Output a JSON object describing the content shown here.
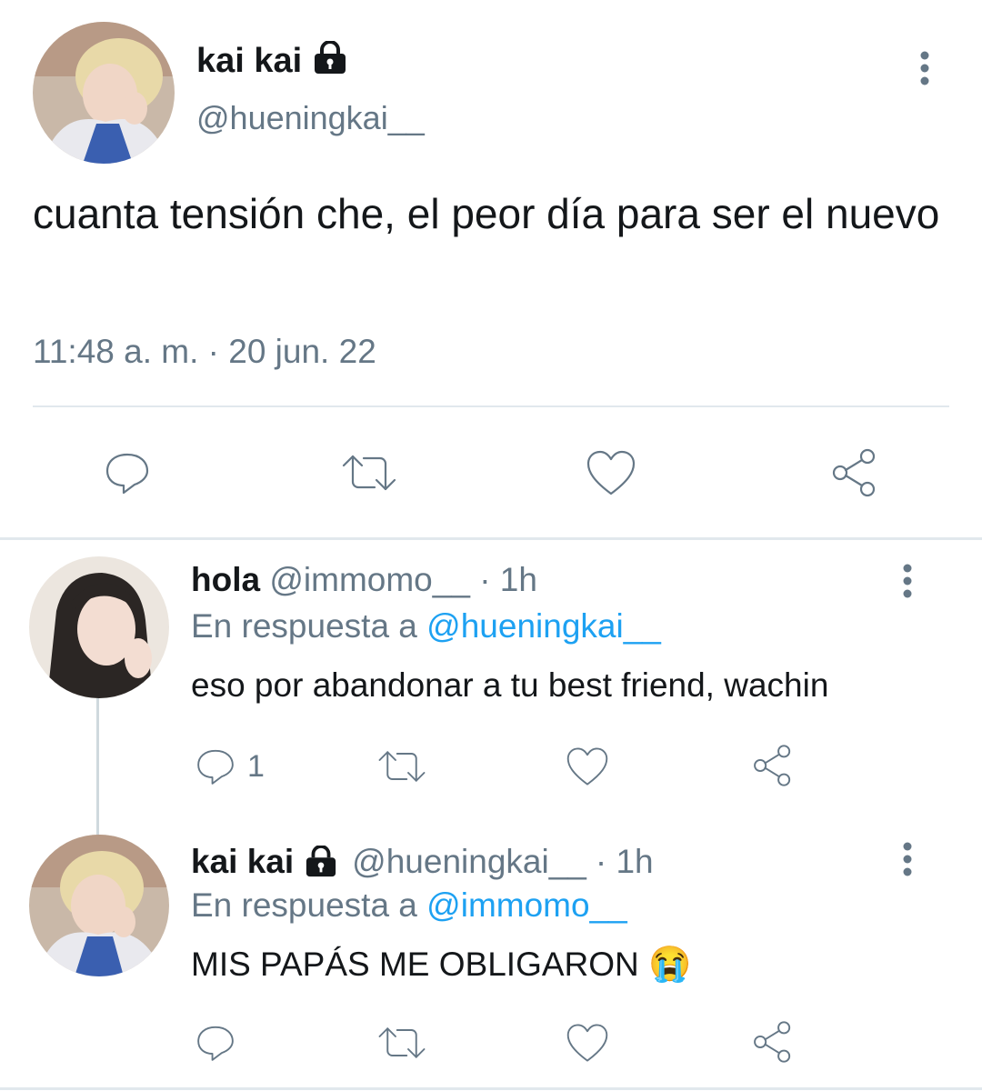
{
  "main_tweet": {
    "author_name": "kai kai",
    "handle": "@hueningkai__",
    "text": "cuanta tensión che, el peor día para ser el nuevo",
    "timestamp": "11:48 a. m. · 20 jun. 22"
  },
  "replies": [
    {
      "author_name": "hola",
      "handle": "@immomo__",
      "time": "· 1h",
      "reply_prefix": "En respuesta a",
      "reply_to": "@hueningkai__",
      "text": "eso por abandonar a tu best friend, wachin",
      "reply_count": "1"
    },
    {
      "author_name": "kai kai",
      "handle": "@hueningkai__",
      "time": "· 1h",
      "reply_prefix": "En respuesta a",
      "reply_to": "@immomo__",
      "text": "MIS PAPÁS ME OBLIGARON",
      "emoji": "😭"
    }
  ],
  "icons": {
    "reply": "speech-bubble-icon",
    "retweet": "retweet-arrows-icon",
    "like": "heart-outline-icon",
    "share": "share-nodes-icon",
    "more": "vertical-ellipsis-icon",
    "protected": "lock-icon"
  },
  "colors": {
    "link": "#1da1f2",
    "muted": "#657786",
    "text": "#14171a",
    "divider": "#e1e8ed"
  }
}
